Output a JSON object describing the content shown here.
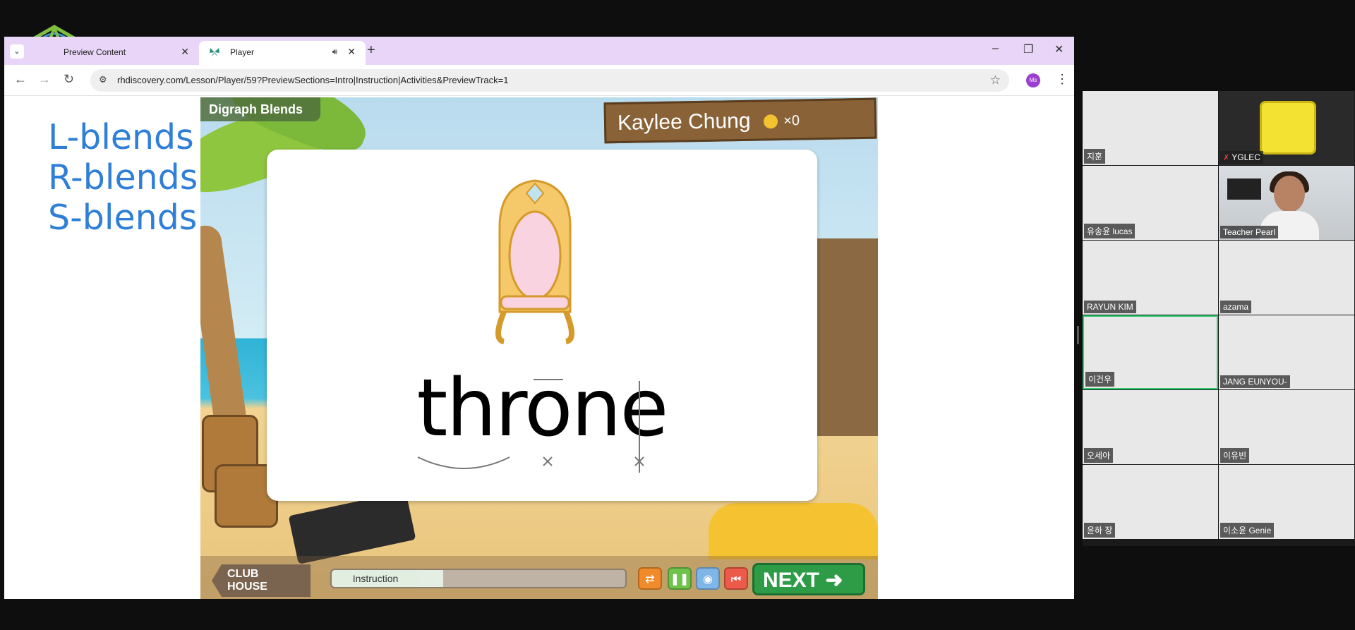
{
  "browser": {
    "tabs": [
      {
        "label": "Preview Content",
        "icon": "globe-icon"
      },
      {
        "label": "Player",
        "icon": "butterfly-icon"
      }
    ],
    "url": "rhdiscovery.com/Lesson/Player/59?PreviewSections=Intro|Instruction|Activities&PreviewTrack=1",
    "profile_initials": "Ms"
  },
  "page": {
    "blends": [
      "L-blends",
      "R-blends",
      "S-blends"
    ]
  },
  "game": {
    "title": "Digraph Blends",
    "student_name": "Kaylee Chung",
    "coins": "×0",
    "word": "throne",
    "clubhouse_label_line1": "CLUB",
    "clubhouse_label_line2": "HOUSE",
    "progress_label": "Instruction",
    "next_label": "NEXT"
  },
  "participants": [
    {
      "name": "지훈"
    },
    {
      "name": "YGLEC",
      "muted": true
    },
    {
      "name": "유송윤 lucas"
    },
    {
      "name": "Teacher Pearl"
    },
    {
      "name": "RAYUN KIM"
    },
    {
      "name": "azama"
    },
    {
      "name": "이건우"
    },
    {
      "name": "JANG EUNYOU-"
    },
    {
      "name": "오세아"
    },
    {
      "name": "이유빈"
    },
    {
      "name": "윤하 장"
    },
    {
      "name": "이소윤 Genie"
    }
  ],
  "colors": {
    "tab_bar": "#e8d5f7",
    "blend_text": "#2f7fd6",
    "next_button": "#2e9b47",
    "active_speaker": "#2ecc71"
  }
}
